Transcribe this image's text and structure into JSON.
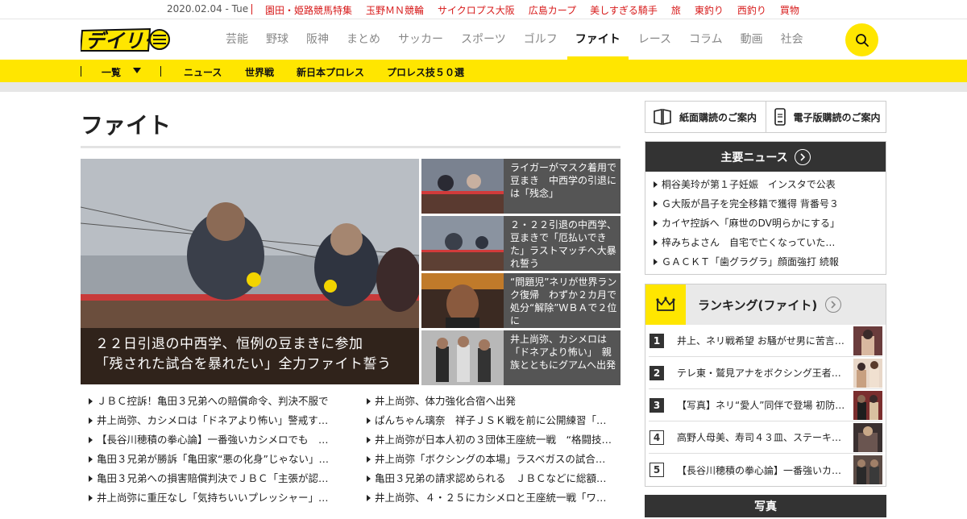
{
  "topbar": {
    "date": "2020.02.04 - Tue",
    "links": [
      "園田・姫路競馬特集",
      "玉野ＭＮ競輪",
      "サイクロプス大阪",
      "広島カープ",
      "美しすぎる騎手",
      "旅",
      "東釣り",
      "西釣り",
      "買物"
    ]
  },
  "header": {
    "logo_text": "デイリー",
    "nav": [
      "芸能",
      "野球",
      "阪神",
      "まとめ",
      "サッカー",
      "スポーツ",
      "ゴルフ",
      "ファイト",
      "レース",
      "コラム",
      "動画",
      "社会"
    ],
    "active_nav": "ファイト"
  },
  "subnav": {
    "list_label": "一覧",
    "items": [
      "ニュース",
      "世界戦",
      "新日本プロレス",
      "プロレス技５０選"
    ]
  },
  "page": {
    "title": "ファイト"
  },
  "hero": {
    "caption_line1": "２２日引退の中西学、恒例の豆まきに参加",
    "caption_line2": "「残された試合を暴れたい」全力ファイト誓う"
  },
  "side_stories": [
    "ライガーがマスク着用で豆まき　中西学の引退には「残念」",
    "２・２２引退の中西学、豆まきで「厄払いできた」ラストマッチへ大暴れ誓う",
    "“問題児”ネリが世界ランク復帰　わずか２カ月で処分“解除”ＷＢＡで２位に",
    "井上尚弥、カシメロは「ドネアより怖い」　親族とともにグアムへ出発"
  ],
  "news_left": [
    "ＪＢＣ控訴！亀田３兄弟への賠償命令、判決不服で",
    "井上尚弥、カシメロは「ドネアより怖い」警戒す…",
    "【長谷川穂積の拳心論】一番強いカシメロでも　…",
    "亀田３兄弟が勝訴「亀田家“悪の化身”じゃない」…",
    "亀田３兄弟への損害賠償判決でＪＢＣ「主張が認…",
    "井上尚弥に重圧なし「気持ちいいプレッシャー」…"
  ],
  "news_right": [
    "井上尚弥、体力強化合宿へ出発",
    "ぱんちゃん璃奈　祥子ＪＳＫ戦を前に公開練習「…",
    "井上尚弥が日本人初の３団体王座統一戦　“格闘技…",
    "井上尚弥「ボクシングの本場」ラスベガスの試合…",
    "亀田３兄弟の請求認められる　ＪＢＣなどに総額…",
    "井上尚弥、４・２５にカシメロと王座統一戦「ワ…"
  ],
  "sidebar": {
    "paper_sub": "紙面購読のご案内",
    "digital_sub": "電子版購読のご案内",
    "main_news_title": "主要ニュース",
    "main_news": [
      "桐谷美玲が第１子妊娠　インスタで公表",
      "Ｇ大阪が昌子を完全移籍で獲得 背番号３",
      "カイヤ控訴へ「麻世のDV明らかにする」",
      "梓みちよさん　自宅で亡くなっていた…",
      "ＧＡＣＫＴ「歯グラグラ」顔面強打 続報"
    ],
    "ranking_title": "ランキング(ファイト)",
    "ranking": [
      {
        "no": "1",
        "text": "井上、ネリ戦希望 お騒がせ男に苦言…"
      },
      {
        "no": "2",
        "text": "テレ東・鷲見アナをボクシング王者が…"
      },
      {
        "no": "3",
        "text": "【写真】ネリ“愛人”同伴で登場 初防衛…"
      },
      {
        "no": "4",
        "text": "高野人母美、寿司４３皿、ステーキ１…"
      },
      {
        "no": "5",
        "text": "【長谷川穂積の拳心論】一番強いカシ…"
      }
    ],
    "photo_title": "写真"
  },
  "colors": {
    "accent": "#ffe600",
    "red_links": "#d71a1a",
    "dark": "#333333"
  }
}
